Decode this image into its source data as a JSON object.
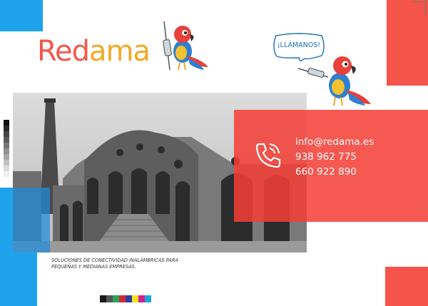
{
  "brand": {
    "logo_part1": "Red",
    "logo_part2": "ama",
    "red": "#f2584b",
    "yellow": "#f2a825",
    "blue": "#1ea3ea"
  },
  "bubble": {
    "text": "¡LLÁMANOS!"
  },
  "contact": {
    "email": "info@redama.es",
    "phone1": "938 962 775",
    "phone2": "660 922 890",
    "icon": "phone-icon"
  },
  "tagline": {
    "line1": "SOLUCIONES DE CONECTIVIDAD INALÁMBRICAS PARA",
    "line2": "PEQUEÑAS Y MEDIANAS EMPRESAS."
  },
  "colors": {
    "panel_red": "#f33e36",
    "accent_blue": "#1ea3ea"
  }
}
